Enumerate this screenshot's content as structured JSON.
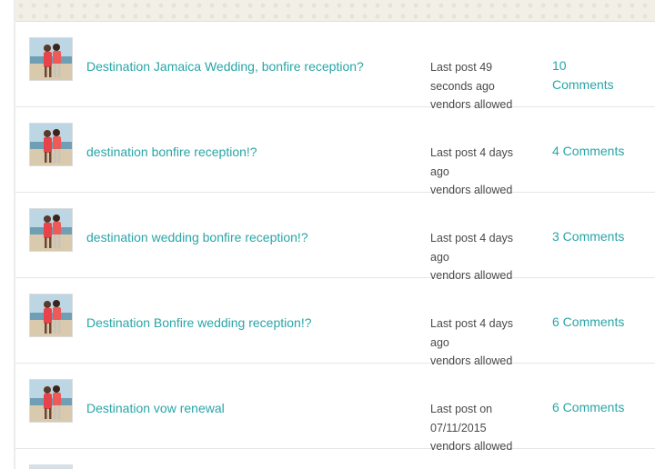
{
  "threads": [
    {
      "title": "Destination Jamaica Wedding, bonfire reception?",
      "last_post_line1": "Last post 49",
      "last_post_line2": "seconds ago",
      "vendors": "vendors allowed",
      "comments": "10 Comments"
    },
    {
      "title": "destination bonfire reception!?",
      "last_post_line1": "Last post 4 days",
      "last_post_line2": "ago",
      "vendors": "vendors allowed",
      "comments": "4 Comments"
    },
    {
      "title": "destination wedding bonfire reception!?",
      "last_post_line1": "Last post 4 days",
      "last_post_line2": "ago",
      "vendors": "vendors allowed",
      "comments": "3 Comments"
    },
    {
      "title": "Destination Bonfire wedding reception!?",
      "last_post_line1": "Last post 4 days",
      "last_post_line2": "ago",
      "vendors": "vendors allowed",
      "comments": "6 Comments"
    },
    {
      "title": "Destination vow renewal",
      "last_post_line1": "Last post on",
      "last_post_line2": "07/11/2015",
      "vendors": "vendors allowed",
      "comments": "6 Comments"
    }
  ],
  "colors": {
    "link": "#2aa5a7",
    "meta_text": "#4a4a4a",
    "divider": "#e6e6e6"
  },
  "icons": {
    "avatar": "user-avatar-photo"
  }
}
